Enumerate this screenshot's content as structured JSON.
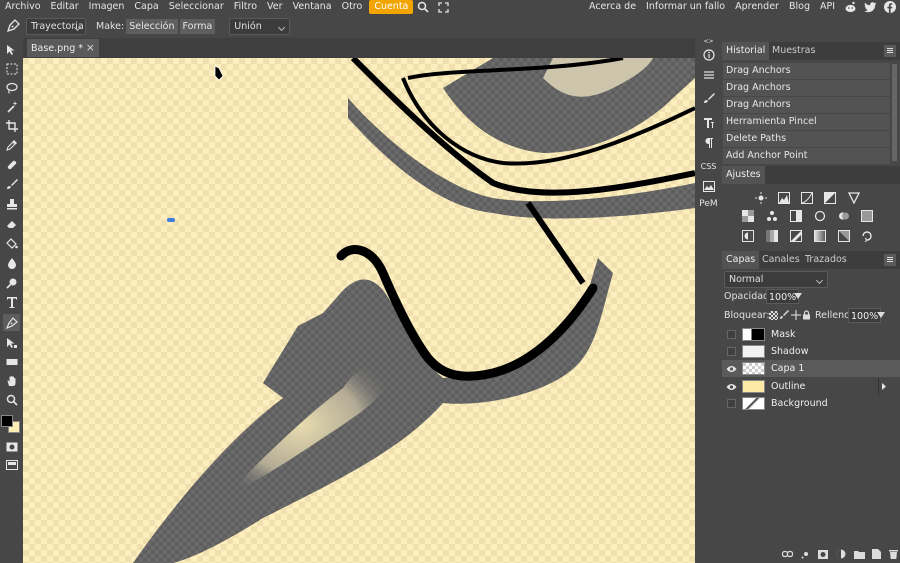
{
  "menu": {
    "items": [
      "Archivo",
      "Editar",
      "Imagen",
      "Capa",
      "Seleccionar",
      "Filtro",
      "Ver",
      "Ventana",
      "Otro"
    ],
    "account": "Cuenta",
    "right_links": [
      "Acerca de",
      "Informar un fallo",
      "Aprender",
      "Blog",
      "API"
    ]
  },
  "options": {
    "mode": "Trayectoria",
    "make_label": "Make:",
    "make_selection": "Selección",
    "make_shape": "Forma",
    "combine": "Unión"
  },
  "document": {
    "tab_title": "Base.png *",
    "close": "×"
  },
  "icon_strip": {
    "css_label": "CSS",
    "pem_label": "PeM"
  },
  "history": {
    "tabs": [
      "Historial",
      "Muestras"
    ],
    "items": [
      "Drag Anchors",
      "Drag Anchors",
      "Drag Anchors",
      "Herramienta Pincel",
      "Delete Paths",
      "Add Anchor Point"
    ]
  },
  "adjustments": {
    "title": "Ajustes"
  },
  "layers": {
    "tabs": [
      "Capas",
      "Canales",
      "Trazados"
    ],
    "blend_mode": "Normal",
    "opacity_label": "Opacidad:",
    "opacity_value": "100%",
    "lock_label": "Bloquear:",
    "fill_label": "Relleno:",
    "fill_value": "100%",
    "items": [
      {
        "name": "Mask",
        "visible": false
      },
      {
        "name": "Shadow",
        "visible": false
      },
      {
        "name": "Capa 1",
        "visible": true,
        "selected": true
      },
      {
        "name": "Outline",
        "visible": true
      },
      {
        "name": "Background",
        "visible": false
      }
    ]
  },
  "colors": {
    "accent": "#f2a500",
    "foreground_color": "#000000",
    "background_color": "#fdedb6",
    "canvas_light": "#fdeebd",
    "canvas_dark": "#f0e0b0"
  }
}
